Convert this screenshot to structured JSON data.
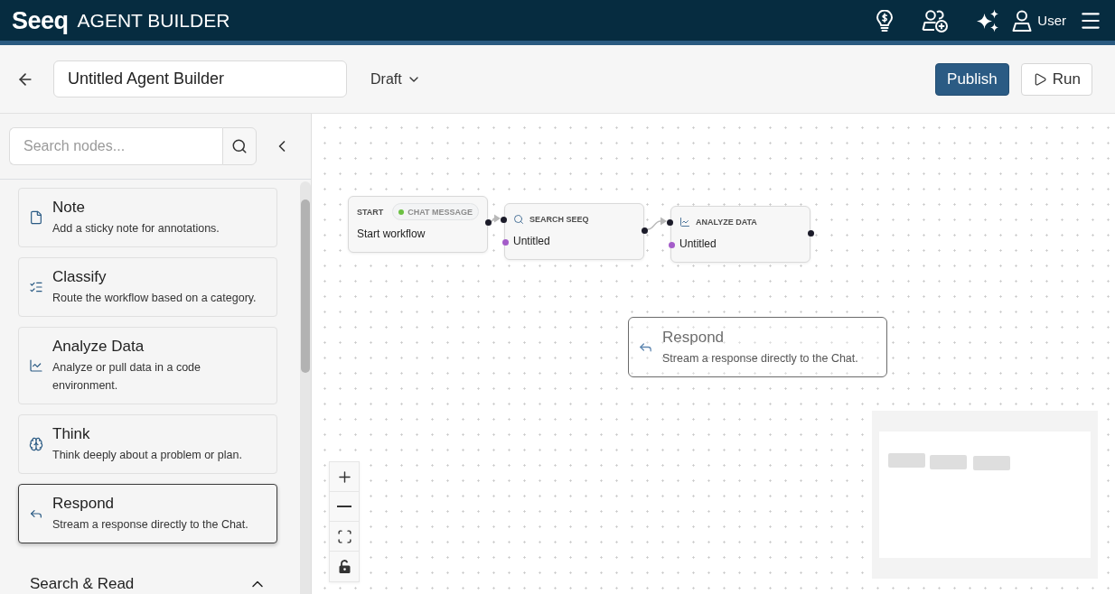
{
  "header": {
    "logo": "Seeq",
    "title": "AGENT BUILDER",
    "user_label": "User"
  },
  "toolbar": {
    "name_field": {
      "value": "Untitled Agent Builder"
    },
    "status_dropdown": {
      "label": "Draft"
    },
    "actions": [
      {
        "kind": "publish",
        "label": "Publish"
      },
      {
        "kind": "run",
        "label": "Run"
      }
    ]
  },
  "sidebar": {
    "search": {
      "placeholder": "Search nodes..."
    },
    "node_types": [
      {
        "kind": "note",
        "title": "Note",
        "description": "Add a sticky note for annotations.",
        "selected": false
      },
      {
        "kind": "classify",
        "title": "Classify",
        "description": "Route the workflow based on a category.",
        "selected": false
      },
      {
        "kind": "analyze",
        "title": "Analyze Data",
        "description": "Analyze or pull data in a code environment.",
        "selected": false
      },
      {
        "kind": "think",
        "title": "Think",
        "description": "Think deeply about a problem or plan.",
        "selected": false
      },
      {
        "kind": "respond",
        "title": "Respond",
        "description": "Stream a response directly to the Chat.",
        "selected": true
      }
    ],
    "sections": [
      {
        "title": "Search & Read",
        "expanded": true
      }
    ]
  },
  "canvas": {
    "nodes": [
      {
        "kind": "start",
        "label": "START",
        "trigger": "CHAT MESSAGE",
        "text": "Start workflow"
      },
      {
        "kind": "search",
        "label": "SEARCH SEEQ",
        "text": "Untitled"
      },
      {
        "kind": "analyze",
        "label": "ANALYZE DATA",
        "text": "Untitled"
      }
    ],
    "dragged_node": {
      "kind": "respond",
      "title": "Respond",
      "description": "Stream a response directly to the Chat."
    }
  }
}
